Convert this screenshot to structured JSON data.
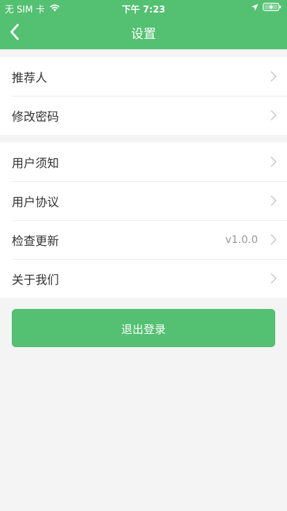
{
  "status_bar": {
    "carrier": "无 SIM 卡",
    "time": "下午 7:23",
    "icons": [
      "wifi-icon",
      "location-arrow-icon",
      "battery-charging-icon"
    ]
  },
  "nav": {
    "title": "设置",
    "back_icon": "chevron-left-icon"
  },
  "settings": {
    "group1": [
      {
        "label": "推荐人",
        "value": ""
      },
      {
        "label": "修改密码",
        "value": ""
      }
    ],
    "group2": [
      {
        "label": "用户须知",
        "value": ""
      },
      {
        "label": "用户协议",
        "value": ""
      },
      {
        "label": "检查更新",
        "value": "v1.0.0"
      },
      {
        "label": "关于我们",
        "value": ""
      }
    ]
  },
  "logout_label": "退出登录",
  "colors": {
    "accent": "#54c071",
    "background": "#f4f4f4"
  }
}
